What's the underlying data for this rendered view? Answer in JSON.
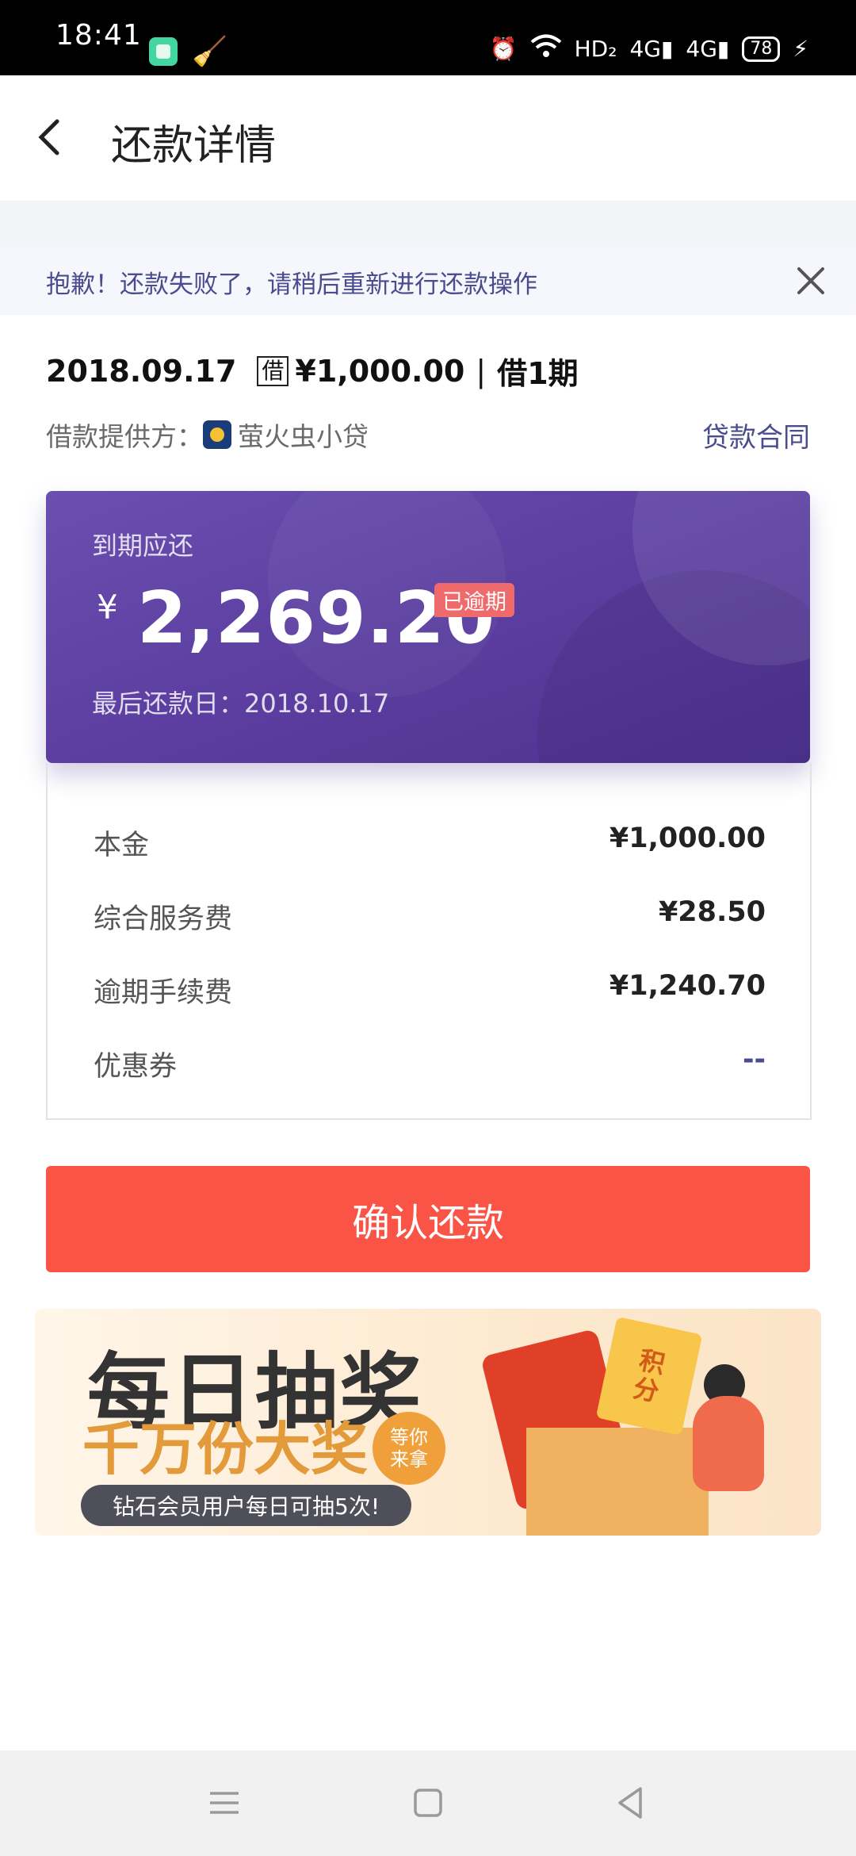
{
  "status_bar": {
    "time": "18:41",
    "network": "HD₂",
    "signal1": "4G",
    "signal2": "4G",
    "battery": "78"
  },
  "header": {
    "title": "还款详情"
  },
  "notice": {
    "text": "抱歉！还款失败了，请稍后重新进行还款操作"
  },
  "loan": {
    "date": "2018.09.17",
    "tag": "借",
    "amount": "¥1,000.00",
    "separator": "|",
    "periods": "借1期",
    "provider_label": "借款提供方：",
    "provider_name": "萤火虫小贷",
    "contract_link": "贷款合同"
  },
  "card": {
    "label": "到期应还",
    "currency": "¥",
    "amount": "2,269.20",
    "status_badge": "已逾期",
    "due_date": "最后还款日：2018.10.17"
  },
  "details": [
    {
      "label": "本金",
      "value": "¥1,000.00"
    },
    {
      "label": "综合服务费",
      "value": "¥28.50"
    },
    {
      "label": "逾期手续费",
      "value": "¥1,240.70"
    },
    {
      "label": "优惠券",
      "value": "--"
    }
  ],
  "confirm_button": "确认还款",
  "banner": {
    "title": "每日抽奖",
    "subtitle": "千万份大奖",
    "badge_line1": "等你",
    "badge_line2": "来拿",
    "note": "钻石会员用户每日可抽5次!",
    "ticket_line1": "积",
    "ticket_line2": "分"
  },
  "colors": {
    "accent_purple": "#5a3d9e",
    "confirm_red": "#fa5446",
    "link_blue": "#4a4c8e",
    "overdue_badge": "#ef6a6a"
  }
}
